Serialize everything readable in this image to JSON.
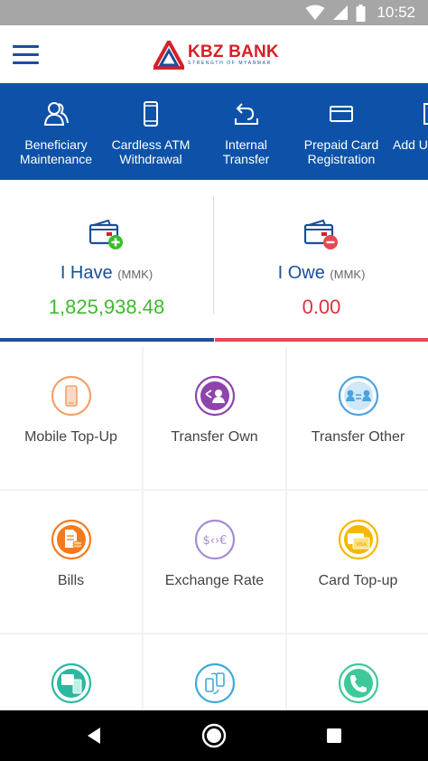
{
  "status_bar": {
    "time": "10:52",
    "icons": [
      "wifi-icon",
      "signal-icon",
      "battery-icon"
    ]
  },
  "app_bar": {
    "menu_icon": "hamburger-menu-icon",
    "logo": {
      "name": "KBZ BANK",
      "tagline": "STRENGTH OF MYANMAR"
    }
  },
  "quick_actions": [
    {
      "label": "Beneficiary\nMaintenance",
      "icon": "beneficiary-icon"
    },
    {
      "label": "Cardless ATM\nWithdrawal",
      "icon": "phone-icon"
    },
    {
      "label": "Internal\nTransfer",
      "icon": "return-arrow-icon"
    },
    {
      "label": "Prepaid Card\nRegistration",
      "icon": "card-icon"
    },
    {
      "label": "Add U",
      "icon": "add-icon"
    }
  ],
  "balances": {
    "have": {
      "title": "I Have",
      "currency": "(MMK)",
      "amount": "1,825,938.48",
      "color": "#3dbb2c"
    },
    "owe": {
      "title": "I Owe",
      "currency": "(MMK)",
      "amount": "0.00",
      "color": "#d8343f"
    }
  },
  "services": [
    {
      "label": "Mobile Top-Up",
      "icon": "mobile-topup-icon",
      "color": "#f4a06a"
    },
    {
      "label": "Transfer Own",
      "icon": "transfer-own-icon",
      "color": "#8e44ad"
    },
    {
      "label": "Transfer Other",
      "icon": "transfer-other-icon",
      "color": "#4aa3df"
    },
    {
      "label": "Bills",
      "icon": "bills-icon",
      "color": "#f47a20"
    },
    {
      "label": "Exchange Rate",
      "icon": "exchange-rate-icon",
      "color": "#a58bd4"
    },
    {
      "label": "Card Top-up",
      "icon": "card-topup-icon",
      "color": "#f5b800"
    },
    {
      "label": "",
      "icon": "atm-mobile-icon",
      "color": "#2bb8a0"
    },
    {
      "label": "",
      "icon": "phone-transfer-icon",
      "color": "#3fa9d9"
    },
    {
      "label": "",
      "icon": "call-icon",
      "color": "#3ec99a"
    }
  ],
  "nav_bar": {
    "icons": [
      "back-icon",
      "home-icon",
      "recents-icon"
    ]
  }
}
